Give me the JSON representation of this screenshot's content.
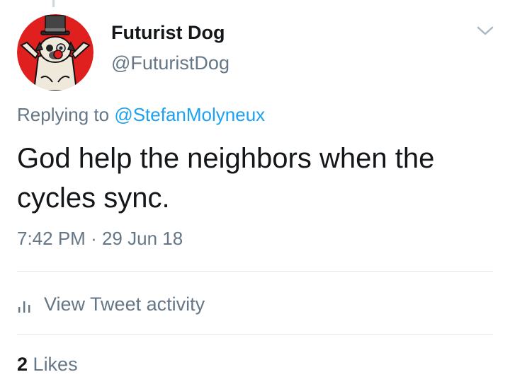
{
  "tweet": {
    "author": {
      "display_name": "Futurist Dog",
      "handle": "@FuturistDog",
      "avatar_icon": "top-hat-pug-avatar"
    },
    "menu_icon": "chevron-down-icon",
    "replying_prefix": "Replying to",
    "replying_to": "@StefanMolyneux",
    "text": "God help the neighbors when the cycles sync.",
    "time": "7:42 PM",
    "separator": "·",
    "date": "29 Jun 18"
  },
  "activity": {
    "icon": "bar-chart-icon",
    "label": "View Tweet activity"
  },
  "stats": {
    "likes_count": "2",
    "likes_label": "Likes"
  },
  "colors": {
    "text": "#14171a",
    "secondary": "#657786",
    "link": "#1da1f2",
    "divider": "#e1e8ed",
    "avatar_bg": "#e0201f"
  }
}
